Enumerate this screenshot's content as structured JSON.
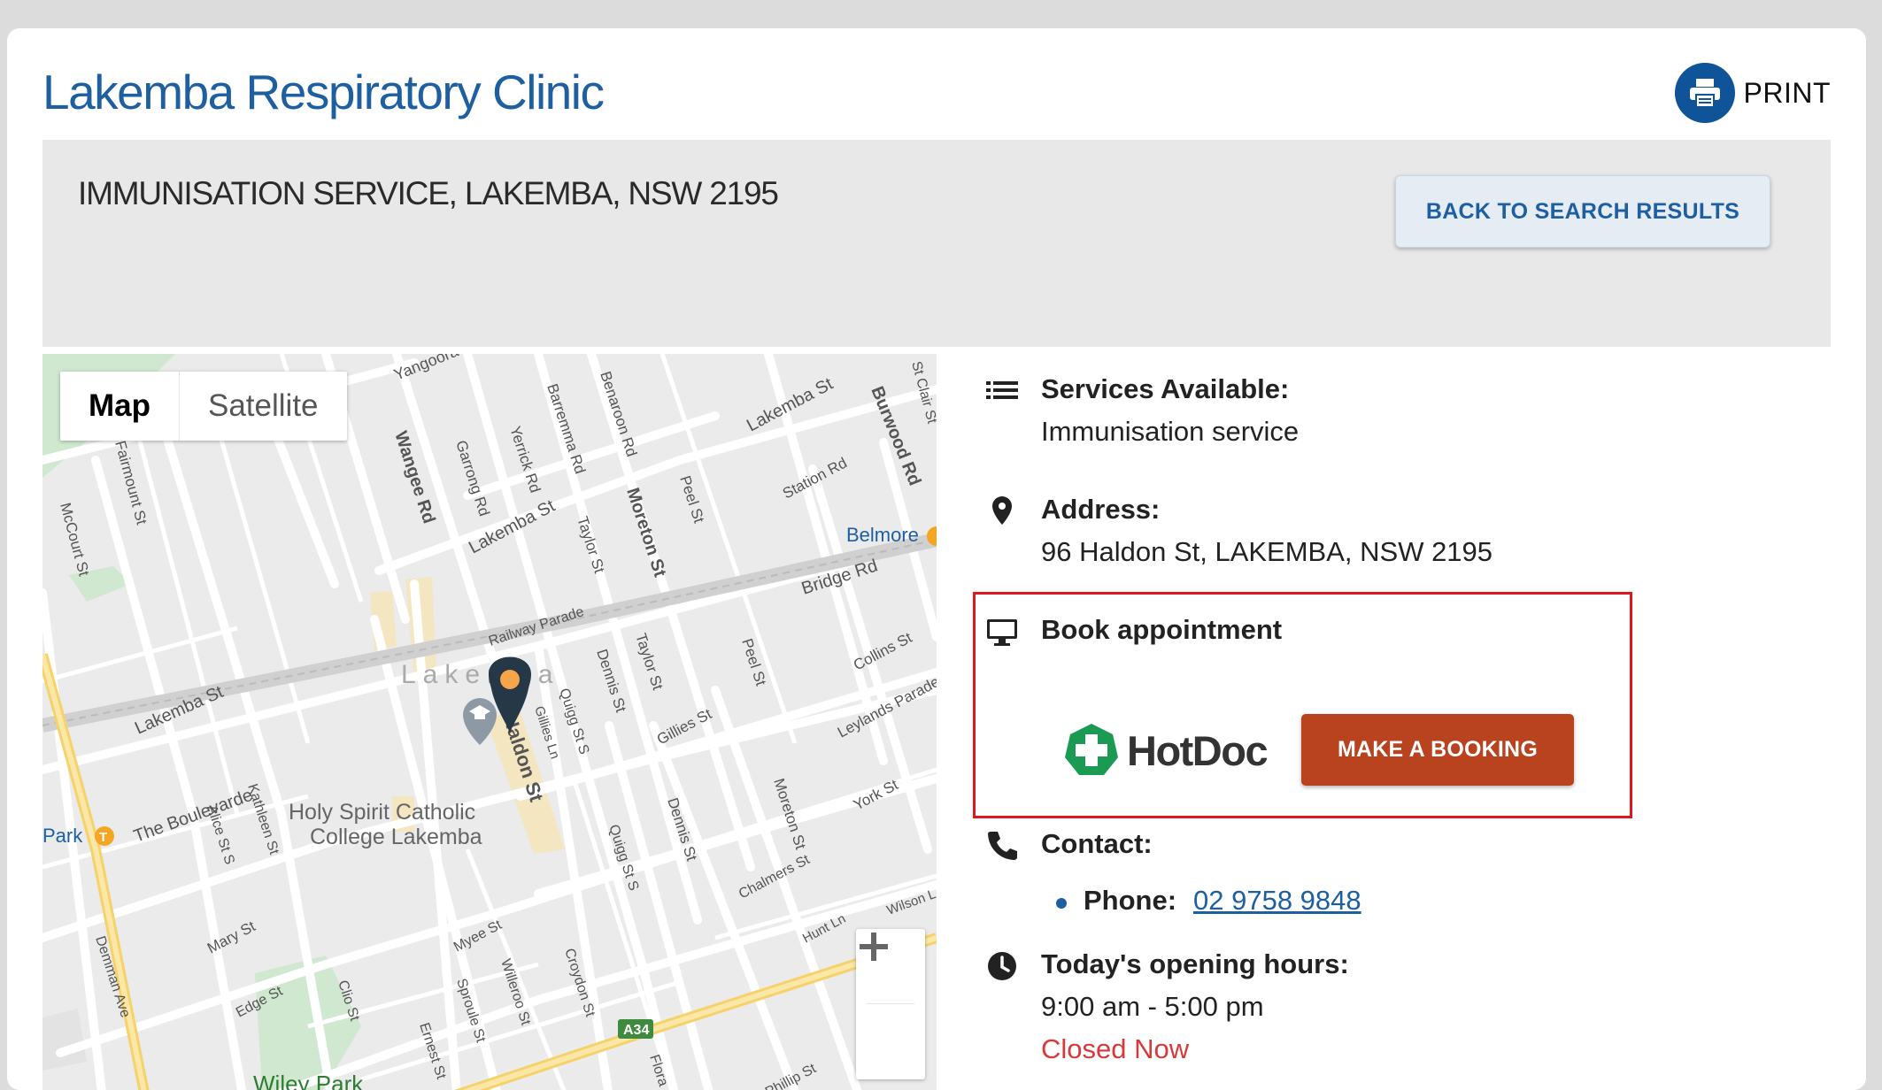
{
  "page": {
    "title": "Lakemba Respiratory Clinic",
    "print_label": "PRINT",
    "subtitle": "IMMUNISATION SERVICE, LAKEMBA, NSW 2195",
    "back_button": "BACK TO SEARCH RESULTS"
  },
  "map": {
    "tabs": [
      "Map",
      "Satellite"
    ],
    "active_tab": "Map",
    "zoom_in": "+",
    "zoom_out": "−",
    "labels": {
      "yangoora": "Yangoora",
      "lakemba_st_ne": "Lakemba St",
      "burwood_rd": "Burwood Rd",
      "st_clair": "St Clair St",
      "fairmount": "Fairmount St",
      "mccourt": "McCourt St",
      "wangee": "Wangee Rd",
      "garrong": "Garrong Rd",
      "yerrick": "Yerrick Rd",
      "barremma": "Barremma Rd",
      "benaroon": "Benaroon Rd",
      "lakemba_st_mid": "Lakemba St",
      "taylor_n": "Taylor St",
      "moreton_n": "Moreton St",
      "peel_n": "Peel St",
      "station_rd": "Station Rd",
      "belmore": "Belmore",
      "bridge_rd": "Bridge Rd",
      "railway_parade": "Railway Parade",
      "lakemba_suburb": "Lakemba",
      "dennis_n": "Dennis St",
      "taylor_s": "Taylor St",
      "peel_s": "Peel St",
      "collins": "Collins St",
      "lakemba_st_sw": "Lakemba St",
      "haldon": "Haldon St",
      "gillies_ln": "Gillies Ln",
      "quigg_n": "Quigg St S",
      "gillies_st": "Gillies St",
      "leylands": "Leylands Parade",
      "park": "Park",
      "boulevarde": "The Boulevarde",
      "alice": "Alice St S",
      "kathleen": "Kathleen St",
      "school1": "Holy Spirit Catholic",
      "school2": "College Lakemba",
      "york": "York St",
      "quigg_s": "Quigg St S",
      "dennis_s": "Dennis St",
      "moreton_s": "Moreton St",
      "chalmers": "Chalmers St",
      "wilson": "Wilson L",
      "mary": "Mary St",
      "myee": "Myee St",
      "demman": "Demman Ave",
      "hunt": "Hunt Ln",
      "edge": "Edge St",
      "clio": "Clio St",
      "sproule": "Sproule St",
      "willeroo": "Willeroo St",
      "croydon": "Croydon St",
      "a34": "A34",
      "ernest": "Ernest St",
      "wiley_park": "Wiley Park",
      "phillip": "Phillip St",
      "flora": "Flora"
    }
  },
  "details": {
    "services_label": "Services Available:",
    "services_value": "Immunisation service",
    "address_label": "Address:",
    "address_value": "96 Haldon St, LAKEMBA, NSW 2195",
    "book_label": "Book appointment",
    "hotdoc_name": "HotDoc",
    "booking_button": "MAKE A BOOKING",
    "contact_label": "Contact:",
    "phone_label": "Phone:",
    "phone_number": "02 9758 9848",
    "hours_label": "Today's opening hours:",
    "hours_value": "9:00 am - 5:00 pm",
    "status": "Closed Now"
  },
  "colors": {
    "title_blue": "#1e5fa1",
    "print_circle": "#0f5399",
    "booking_button": "#b9421f",
    "hotdoc_green": "#1b9a54",
    "closed_red": "#d83a3a",
    "highlight_border": "#e0161d"
  },
  "icons": {
    "print": "printer-icon",
    "services": "list-icon",
    "address": "map-pin-icon",
    "book": "monitor-icon",
    "contact": "phone-icon",
    "hours": "clock-icon"
  }
}
